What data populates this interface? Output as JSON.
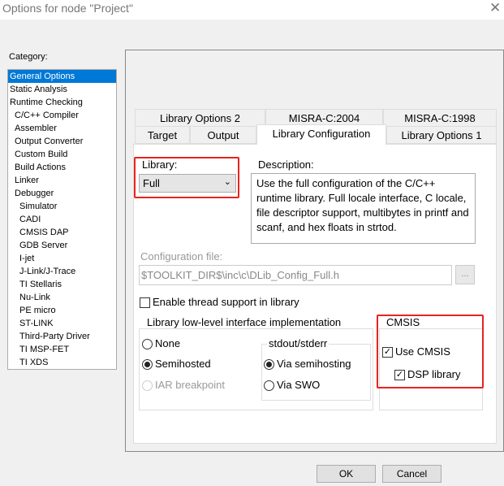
{
  "window": {
    "title": "Options for node \"Project\"",
    "close": "✕"
  },
  "category": {
    "label": "Category:",
    "items": [
      {
        "label": "General Options",
        "level": 1,
        "selected": true
      },
      {
        "label": "Static Analysis",
        "level": 1
      },
      {
        "label": "Runtime Checking",
        "level": 1
      },
      {
        "label": "C/C++ Compiler",
        "level": 2
      },
      {
        "label": "Assembler",
        "level": 2
      },
      {
        "label": "Output Converter",
        "level": 2
      },
      {
        "label": "Custom Build",
        "level": 2
      },
      {
        "label": "Build Actions",
        "level": 2
      },
      {
        "label": "Linker",
        "level": 2
      },
      {
        "label": "Debugger",
        "level": 2
      },
      {
        "label": "Simulator",
        "level": 3
      },
      {
        "label": "CADI",
        "level": 3
      },
      {
        "label": "CMSIS DAP",
        "level": 3
      },
      {
        "label": "GDB Server",
        "level": 3
      },
      {
        "label": "I-jet",
        "level": 3
      },
      {
        "label": "J-Link/J-Trace",
        "level": 3
      },
      {
        "label": "TI Stellaris",
        "level": 3
      },
      {
        "label": "Nu-Link",
        "level": 3
      },
      {
        "label": "PE micro",
        "level": 3
      },
      {
        "label": "ST-LINK",
        "level": 3
      },
      {
        "label": "Third-Party Driver",
        "level": 3
      },
      {
        "label": "TI MSP-FET",
        "level": 3
      },
      {
        "label": "TI XDS",
        "level": 3
      }
    ]
  },
  "tabs": {
    "row1": [
      "Library Options 2",
      "MISRA-C:2004",
      "MISRA-C:1998"
    ],
    "row2": [
      "Target",
      "Output",
      "Library Configuration",
      "Library Options 1"
    ],
    "active": "Library Configuration"
  },
  "library": {
    "label": "Library:",
    "value": "Full"
  },
  "description": {
    "label": "Description:",
    "text": "Use the full configuration of the C/C++ runtime library. Full locale interface, C locale, file descriptor support, multibytes in printf and scanf, and hex floats in strtod."
  },
  "config_file": {
    "label": "Configuration file:",
    "value": "$TOOLKIT_DIR$\\inc\\c\\DLib_Config_Full.h",
    "browse": "..."
  },
  "thread_support": {
    "label": "Enable thread support in library",
    "checked": false
  },
  "lowlevel": {
    "title": "Library low-level interface implementation",
    "options": [
      "None",
      "Semihosted",
      "IAR breakpoint"
    ],
    "selected": "Semihosted"
  },
  "stdout": {
    "title": "stdout/stderr",
    "options": [
      "Via semihosting",
      "Via SWO"
    ],
    "selected": "Via semihosting"
  },
  "cmsis": {
    "title": "CMSIS",
    "use_cmsis": {
      "label": "Use CMSIS",
      "checked": true
    },
    "dsp": {
      "label": "DSP library",
      "checked": true
    }
  },
  "buttons": {
    "ok": "OK",
    "cancel": "Cancel"
  },
  "colors": {
    "selection": "#0078d7",
    "highlight_box": "#e8231e"
  }
}
